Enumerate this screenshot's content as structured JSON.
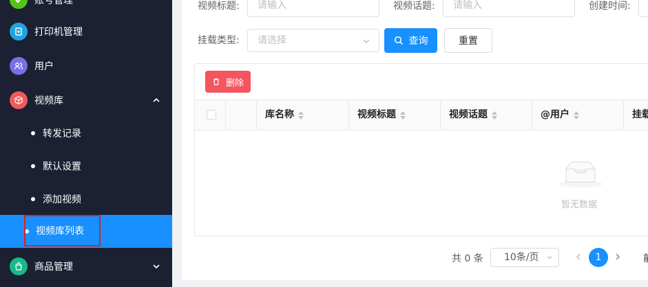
{
  "sidebar": {
    "items": [
      {
        "label": "账号管理",
        "icon": "partial-icon",
        "color": "#52c41a"
      },
      {
        "label": "打印机管理",
        "icon": "printer-file-icon",
        "color": "#1fa5e0"
      },
      {
        "label": "用户",
        "icon": "users-icon",
        "color": "#7b6ee6"
      },
      {
        "label": "视频库",
        "icon": "cube-icon",
        "color": "#f05a5a"
      },
      {
        "label": "商品管理",
        "icon": "shop-bag-icon",
        "color": "#19b98a"
      }
    ],
    "sub_items": [
      "转发记录",
      "默认设置",
      "添加视频",
      "视频库列表"
    ]
  },
  "filters": {
    "video_title_label": "视频标题:",
    "video_title_placeholder": "请输入",
    "video_topic_label": "视频话题:",
    "video_topic_placeholder": "请输入",
    "created_time_label": "创建时间:",
    "mount_type_label": "挂载类型:",
    "mount_type_placeholder": "请选择"
  },
  "buttons": {
    "search": "查询",
    "reset": "重置",
    "delete": "删除"
  },
  "table": {
    "columns": [
      "库名称",
      "视频标题",
      "视频话题",
      "@用户",
      "挂载"
    ],
    "empty_text": "暂无数据"
  },
  "pagination": {
    "total": "共 0 条",
    "page_size": "10条/页",
    "current_page": "1",
    "front_text": "前"
  },
  "colors": {
    "primary": "#1890ff",
    "danger": "#f5555e",
    "sidebar_bg": "#1c2033",
    "highlight": "#e02020"
  }
}
